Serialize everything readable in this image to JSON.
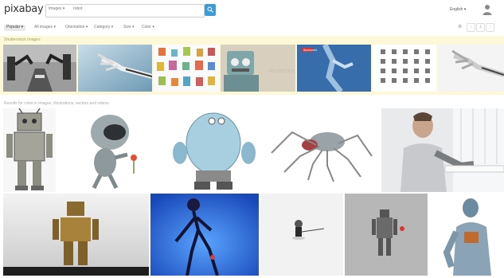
{
  "header": {
    "logo": "pixabay",
    "search_category": "Images ▾",
    "search_query": "robot",
    "language": "English ▾"
  },
  "toolbar": {
    "items": [
      "Popular ▾",
      "All images ▾",
      "Orientation ▾",
      "Category ▾",
      "Size ▾",
      "Color ▾"
    ],
    "gear": "⚙",
    "pager": [
      "‹",
      "1",
      "›"
    ]
  },
  "sponsor": {
    "label": "Shutterstock Images",
    "badge": "Sponsored",
    "watermark": "shutterstock"
  },
  "results": {
    "label": "Results for robot in images, illustrations, vectors and videos"
  },
  "colors": {
    "accent": "#3d9bd6",
    "sponsor_bg": "#fdf9d8"
  }
}
